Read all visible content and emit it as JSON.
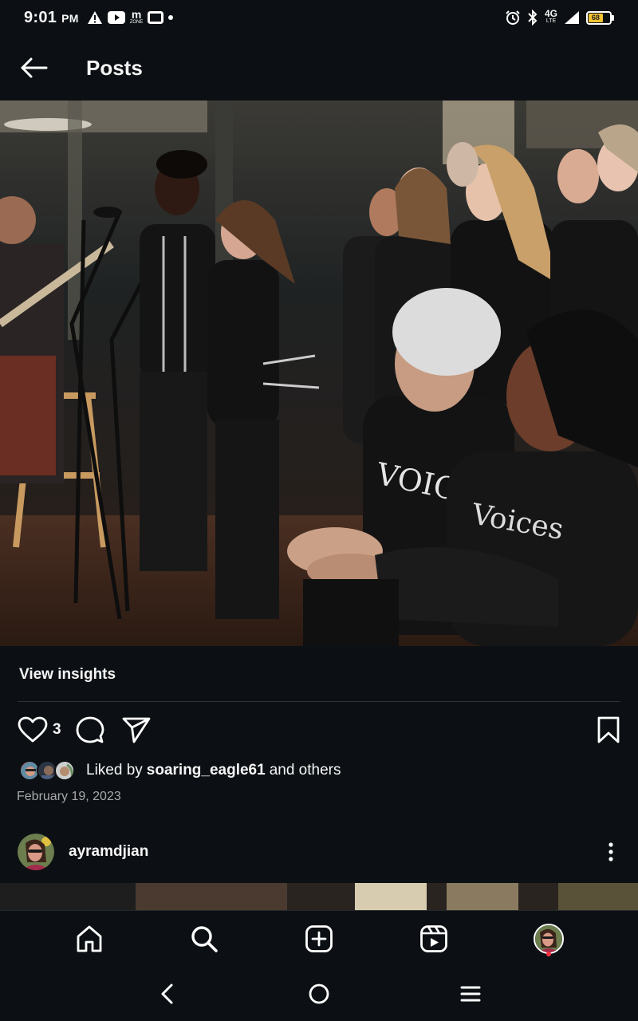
{
  "status_bar": {
    "time": "9:01",
    "ampm": "PM",
    "network": "4G",
    "network_sub": "LTE",
    "battery_level": "68",
    "battery_fraction": 0.68,
    "battery_color": "#f2c232",
    "icons": [
      "warning-icon",
      "youtube-icon",
      "mzone-icon",
      "screen-icon",
      "dot-icon",
      "alarm-icon",
      "bluetooth-icon",
      "signal-icon",
      "battery-icon"
    ],
    "mzone_top": "m",
    "mzone_bottom": "ZONE"
  },
  "header": {
    "back_icon": "arrow-left-icon",
    "title": "Posts"
  },
  "post": {
    "view_insights": "View insights",
    "like_count": "3",
    "liked_by_prefix": "Liked by",
    "liked_by_user": "soaring_eagle61",
    "liked_by_suffix": "and others",
    "date": "February 19, 2023"
  },
  "next_post": {
    "username": "ayramdjian"
  },
  "bottom_nav": {
    "tabs": [
      "home-icon",
      "search-icon",
      "create-icon",
      "reels-icon",
      "profile-avatar"
    ],
    "notification_color": "#ff3040"
  },
  "system_nav": [
    "back-icon",
    "home-circle-icon",
    "menu-icon"
  ],
  "colors": {
    "background": "#0c1014",
    "text": "#f5f5f5",
    "muted": "#a8a8a8"
  }
}
